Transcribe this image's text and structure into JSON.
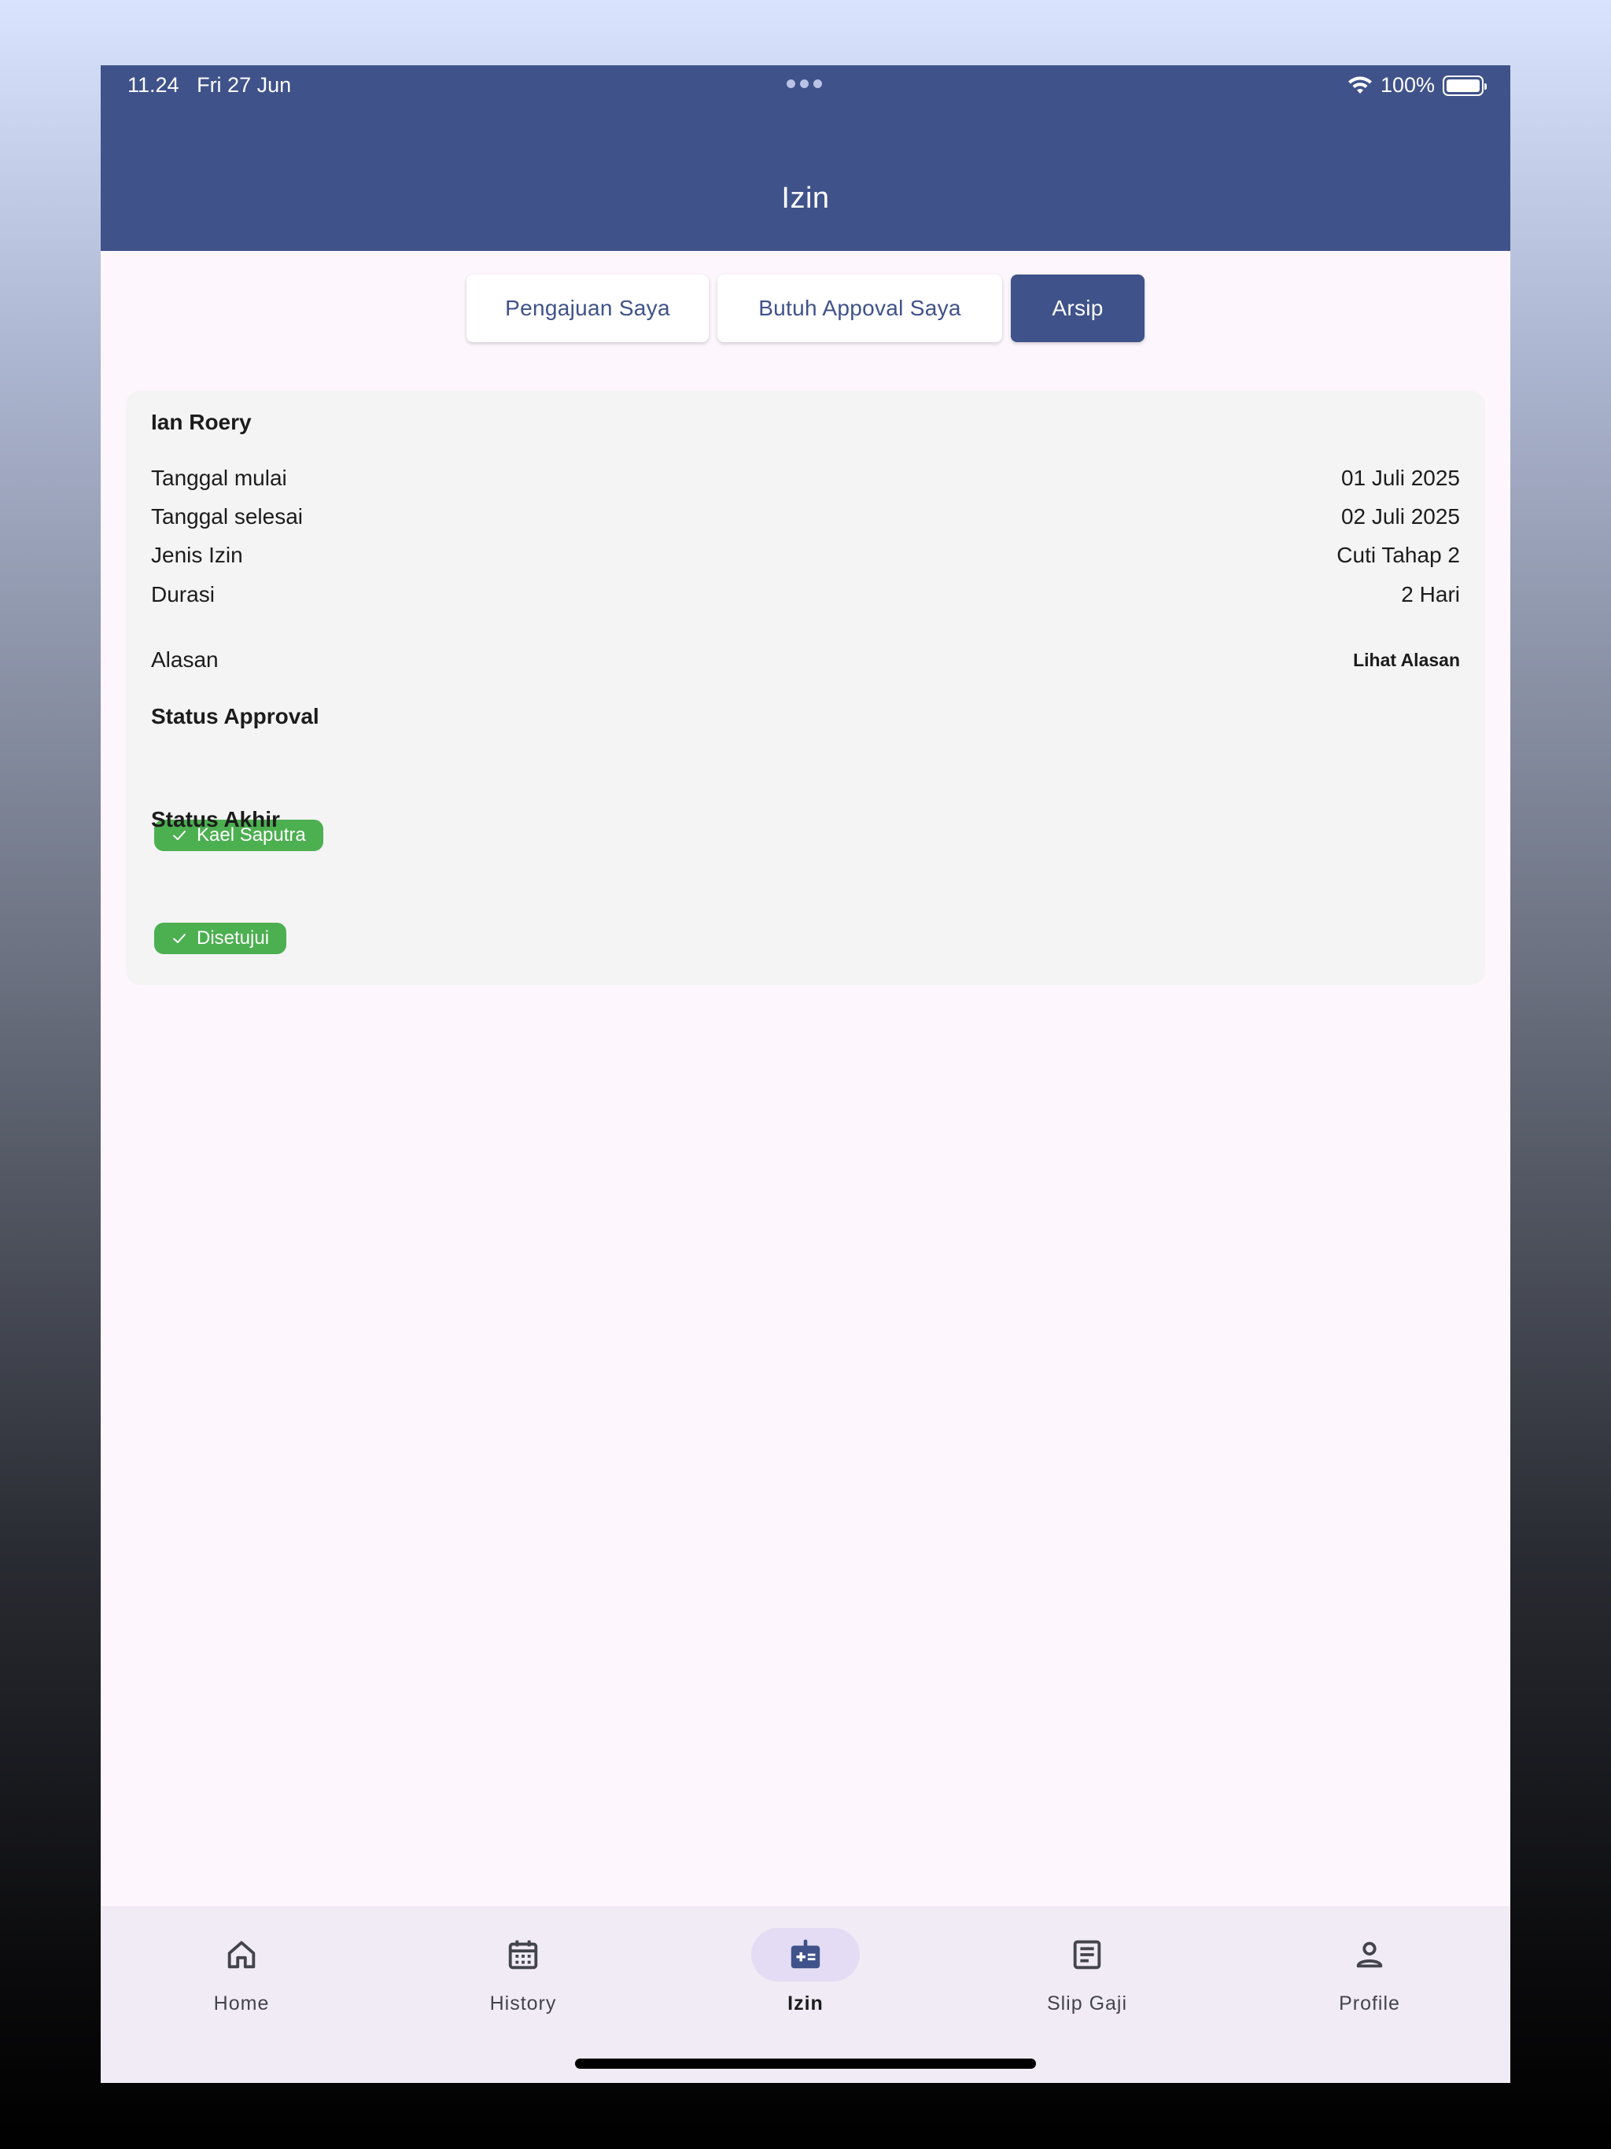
{
  "status_bar": {
    "time": "11.24",
    "date": "Fri 27 Jun",
    "battery": "100%"
  },
  "header": {
    "title": "Izin"
  },
  "tabs": [
    {
      "label": "Pengajuan Saya",
      "active": false
    },
    {
      "label": "Butuh Appoval Saya",
      "active": false
    },
    {
      "label": "Arsip",
      "active": true
    }
  ],
  "card": {
    "name": "Ian Roery",
    "rows": [
      {
        "label": "Tanggal mulai",
        "value": "01 Juli 2025"
      },
      {
        "label": "Tanggal selesai",
        "value": "02 Juli 2025"
      },
      {
        "label": "Jenis Izin",
        "value": "Cuti Tahap 2"
      },
      {
        "label": "Durasi",
        "value": "2 Hari"
      }
    ],
    "reason_label": "Alasan",
    "reason_link": "Lihat Alasan",
    "approval_title": "Status Approval",
    "approver_chip": "Kael Saputra",
    "final_title": "Status Akhir",
    "final_chip": "Disetujui"
  },
  "bottom_nav": [
    {
      "label": "Home",
      "icon": "home-icon"
    },
    {
      "label": "History",
      "icon": "calendar-icon"
    },
    {
      "label": "Izin",
      "icon": "medical-bag-icon",
      "active": true
    },
    {
      "label": "Slip Gaji",
      "icon": "document-icon"
    },
    {
      "label": "Profile",
      "icon": "person-icon"
    }
  ],
  "colors": {
    "primary": "#3f528a",
    "background": "#fdf6fd",
    "card": "#f4f4f4",
    "chip_green": "#4caf50",
    "nav_background": "#f1ebf5",
    "nav_active_pill": "#e3dcf4"
  }
}
